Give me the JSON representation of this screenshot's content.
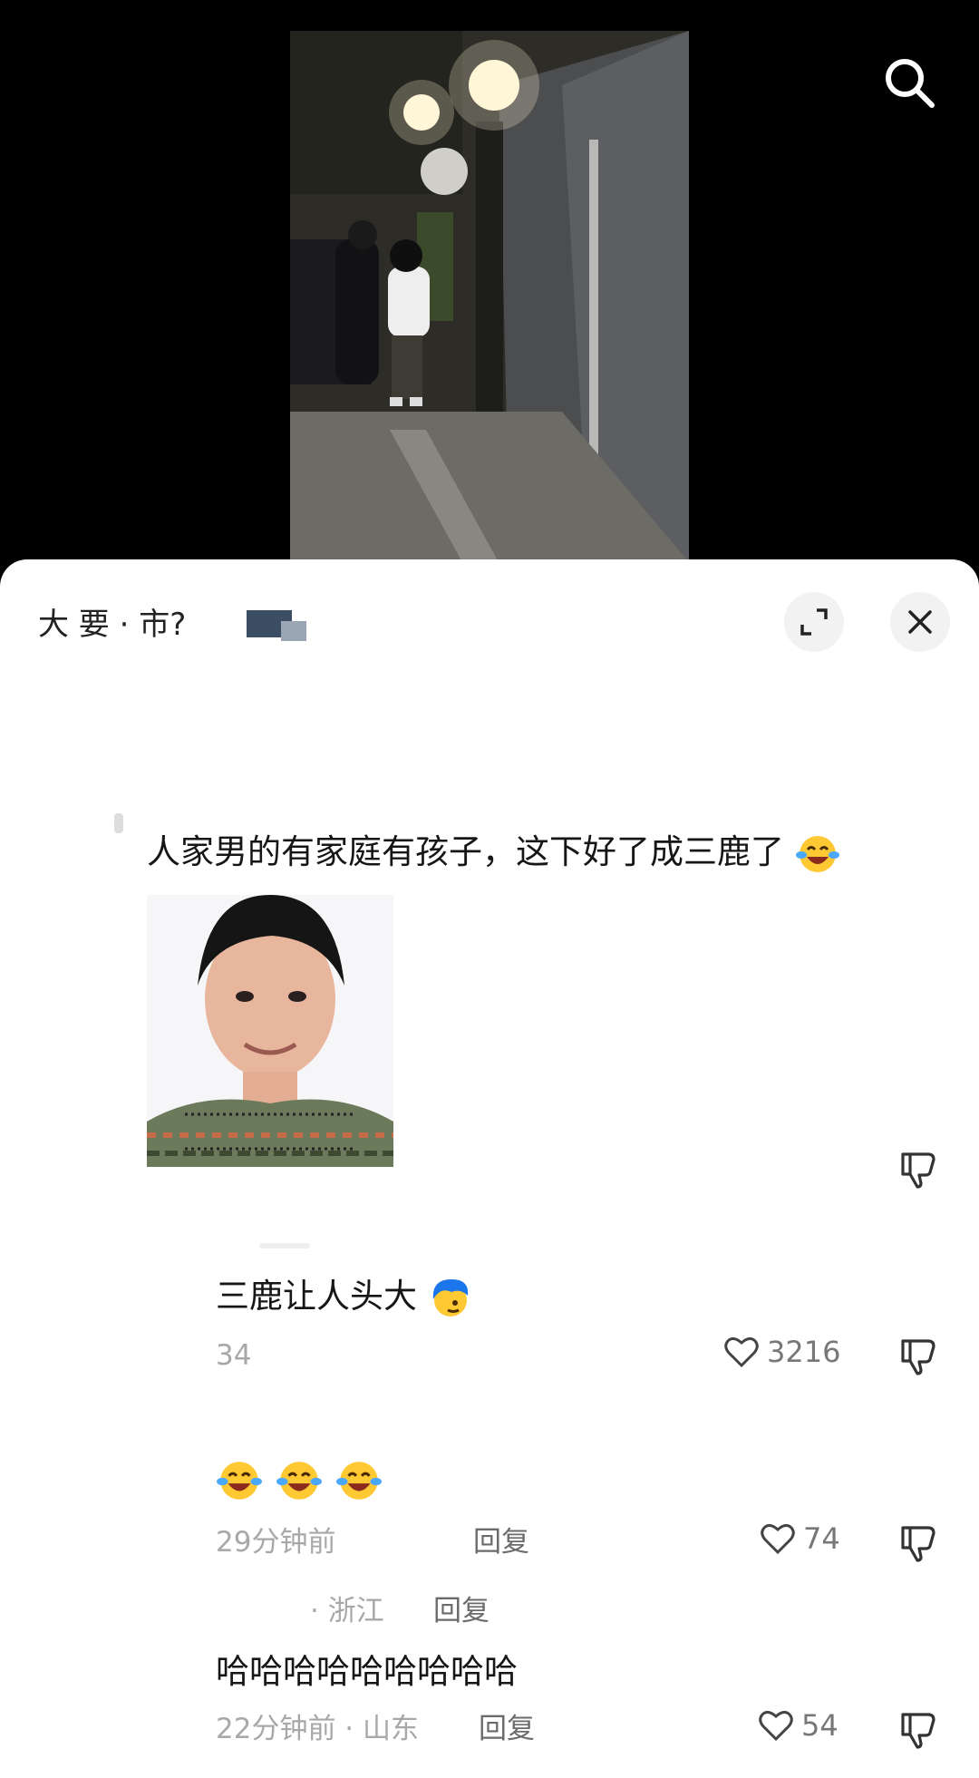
{
  "header": {
    "title": "大         要 ·  市?"
  },
  "comments": [
    {
      "text": "人家男的有家庭有孩子，这下好了成三鹿了",
      "emoji": "laugh-cry-emoji"
    },
    {
      "text": "三鹿让人头大",
      "emoji": "blue-hair-emoji",
      "meta": "34",
      "likes": "3216"
    },
    {
      "meta": "29分钟前",
      "reply": "回复",
      "likes": "74"
    },
    {
      "meta": "· 浙江",
      "reply": "回复"
    },
    {
      "text": "哈哈哈哈哈哈哈哈哈",
      "meta": "22分钟前 · 山东",
      "reply": "回复",
      "likes": "54"
    }
  ],
  "icons": {
    "search": "search-icon",
    "expand": "expand-icon",
    "close": "close-icon",
    "like": "heart-icon",
    "dislike": "thumbs-down-icon"
  }
}
